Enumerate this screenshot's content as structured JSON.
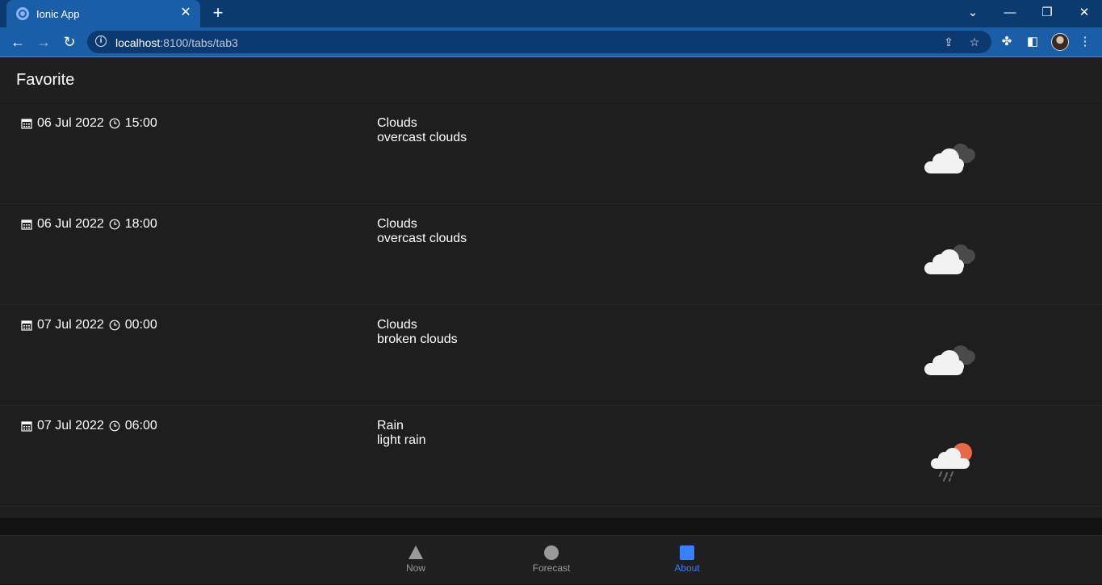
{
  "browser": {
    "tab_title": "Ionic App",
    "tab_close": "✕",
    "new_tab": "+",
    "url_host": "localhost",
    "url_path": ":8100/tabs/tab3"
  },
  "app": {
    "header_title": "Favorite",
    "items": [
      {
        "date": "06 Jul 2022",
        "time": "15:00",
        "main": "Clouds",
        "description": "overcast clouds",
        "icon": "overcast-clouds"
      },
      {
        "date": "06 Jul 2022",
        "time": "18:00",
        "main": "Clouds",
        "description": "overcast clouds",
        "icon": "overcast-clouds"
      },
      {
        "date": "07 Jul 2022",
        "time": "00:00",
        "main": "Clouds",
        "description": "broken clouds",
        "icon": "broken-clouds"
      },
      {
        "date": "07 Jul 2022",
        "time": "06:00",
        "main": "Rain",
        "description": "light rain",
        "icon": "light-rain"
      }
    ],
    "tabs": [
      {
        "label": "Now",
        "icon": "triangle-icon"
      },
      {
        "label": "Forecast",
        "icon": "circle-icon"
      },
      {
        "label": "About",
        "icon": "square-icon",
        "active": true
      }
    ]
  },
  "colors": {
    "accent": "#3880ff",
    "chrome_blue": "#1b5ea8"
  }
}
